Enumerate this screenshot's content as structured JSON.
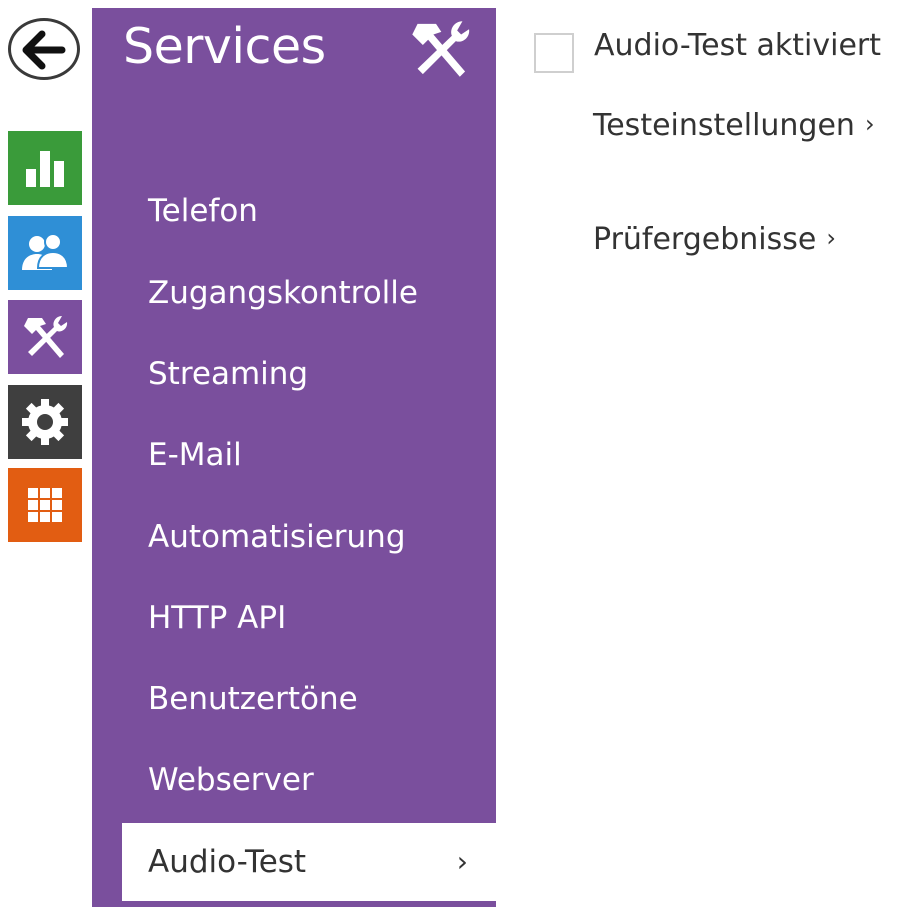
{
  "rail": {
    "back_icon": "back-arrow-icon",
    "tiles": [
      {
        "name": "status",
        "icon": "bar-chart-icon",
        "color": "#3a9b3a"
      },
      {
        "name": "users",
        "icon": "users-icon",
        "color": "#2f8fd6"
      },
      {
        "name": "services",
        "icon": "hammer-wrench-icon",
        "color": "#7b4f9e"
      },
      {
        "name": "system",
        "icon": "gear-icon",
        "color": "#3f3f3f"
      },
      {
        "name": "apps",
        "icon": "grid-icon",
        "color": "#e25d12"
      }
    ]
  },
  "panel": {
    "title": "Services",
    "title_icon": "hammer-wrench-icon",
    "color": "#7a4f9d",
    "items": [
      {
        "label": "Telefon"
      },
      {
        "label": "Zugangskontrolle"
      },
      {
        "label": "Streaming"
      },
      {
        "label": "E-Mail"
      },
      {
        "label": "Automatisierung"
      },
      {
        "label": "HTTP API"
      },
      {
        "label": "Benutzertöne"
      },
      {
        "label": "Webserver"
      },
      {
        "label": "Audio-Test",
        "active": true,
        "chevron": "›"
      }
    ]
  },
  "main": {
    "checkbox_label": "Audio-Test aktiviert",
    "checkbox_checked": false,
    "links": [
      {
        "label": "Testeinstellungen",
        "chevron": "›"
      },
      {
        "label": "Prüfergebnisse",
        "chevron": "›"
      }
    ]
  }
}
